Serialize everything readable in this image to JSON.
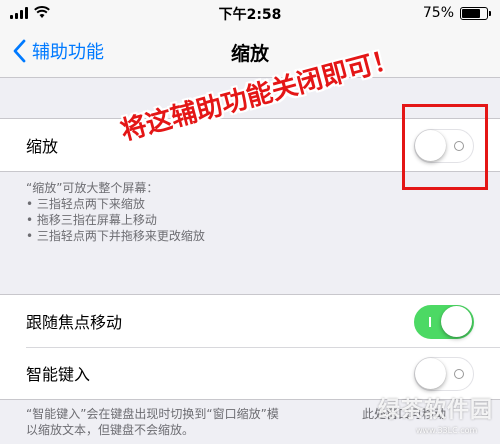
{
  "status_bar": {
    "time": "下午2:58",
    "battery_percent": "75%",
    "battery_level": 0.75
  },
  "nav": {
    "back_label": "辅助功能",
    "title": "缩放"
  },
  "zoom_group": {
    "label": "缩放",
    "toggle_on": false
  },
  "zoom_footer": [
    "“缩放”可放大整个屏幕：",
    "• 三指轻点两下来缩放",
    "• 拖移三指在屏幕上移动",
    "• 三指轻点两下并拖移来更改缩放"
  ],
  "options_group": [
    {
      "label": "跟随焦点移动",
      "toggle_on": true
    },
    {
      "label": "智能键入",
      "toggle_on": false
    }
  ],
  "bottom_footer": [
    "“智能键入”会在键盘出现时切换到“窗口缩放”模",
    "以缩放文本，但键盘不会缩放。"
  ],
  "bottom_footer_right": "此处窗口可移动",
  "annotation": {
    "text": "将这辅助功能关闭即可！",
    "color": "#e41616"
  },
  "watermark": {
    "logo": "绿茶软件园",
    "url": "www.33LC.com"
  },
  "colors": {
    "accent": "#007aff",
    "toggle_on": "#4cd964"
  }
}
